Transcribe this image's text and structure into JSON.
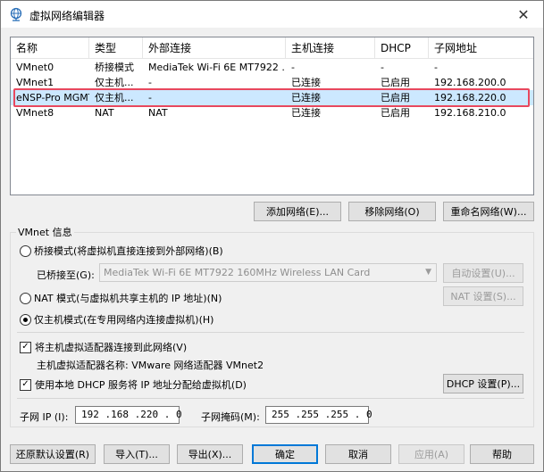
{
  "window": {
    "title": "虚拟网络编辑器",
    "app_icon": "globe-network-icon",
    "close_symbol": "✕"
  },
  "network_list": {
    "columns": [
      "名称",
      "类型",
      "外部连接",
      "主机连接",
      "DHCP",
      "子网地址"
    ],
    "rows": [
      {
        "name": "VMnet0",
        "type": "桥接模式",
        "external": "MediaTek Wi-Fi 6E MT7922 ...",
        "host": "-",
        "dhcp": "-",
        "subnet": "-"
      },
      {
        "name": "VMnet1",
        "type": "仅主机...",
        "external": "-",
        "host": "已连接",
        "dhcp": "已启用",
        "subnet": "192.168.200.0"
      },
      {
        "name": "eNSP-Pro MGMT",
        "type": "仅主机...",
        "external": "-",
        "host": "已连接",
        "dhcp": "已启用",
        "subnet": "192.168.220.0"
      },
      {
        "name": "VMnet8",
        "type": "NAT",
        "external": "NAT",
        "host": "已连接",
        "dhcp": "已启用",
        "subnet": "192.168.210.0"
      }
    ],
    "selected_index": 2,
    "highlight_color": "#e8485e"
  },
  "list_buttons": {
    "add": "添加网络(E)...",
    "remove": "移除网络(O)",
    "rename": "重命名网络(W)..."
  },
  "vmnet_info": {
    "legend": "VMnet 信息",
    "bridge_radio": "桥接模式(将虚拟机直接连接到外部网络)(B)",
    "bridged_to_label": "已桥接至(G):",
    "bridged_to_value": "MediaTek Wi-Fi 6E MT7922 160MHz Wireless LAN Card",
    "auto_settings": "自动设置(U)...",
    "nat_radio": "NAT 模式(与虚拟机共享主机的 IP 地址)(N)",
    "nat_settings": "NAT 设置(S)...",
    "hostonly_radio": "仅主机模式(在专用网络内连接虚拟机)(H)",
    "connect_adapter_check": "将主机虚拟适配器连接到此网络(V)",
    "adapter_name_label": "主机虚拟适配器名称: VMware 网络适配器 VMnet2",
    "dhcp_check": "使用本地 DHCP 服务将 IP 地址分配给虚拟机(D)",
    "dhcp_settings": "DHCP 设置(P)...",
    "subnet_ip_label": "子网 IP (I):",
    "subnet_ip_value": "192 .168 .220 .  0",
    "subnet_mask_label": "子网掩码(M):",
    "subnet_mask_value": "255 .255 .255 .  0",
    "selected_mode": "host-only"
  },
  "footer": {
    "restore_defaults": "还原默认设置(R)",
    "import": "导入(T)...",
    "export": "导出(X)...",
    "ok": "确定",
    "cancel": "取消",
    "apply": "应用(A)",
    "help": "帮助"
  }
}
